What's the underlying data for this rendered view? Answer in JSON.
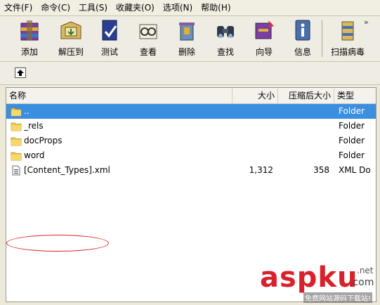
{
  "menu": [
    "文件(F)",
    "命令(C)",
    "工具(S)",
    "收藏夹(O)",
    "选项(N)",
    "帮助(H)"
  ],
  "toolbar": {
    "buttons": [
      {
        "label": "添加",
        "icon": "add-archive-icon"
      },
      {
        "label": "解压到",
        "icon": "extract-to-icon"
      },
      {
        "label": "测试",
        "icon": "test-icon"
      },
      {
        "label": "查看",
        "icon": "view-icon"
      },
      {
        "label": "删除",
        "icon": "delete-icon"
      },
      {
        "label": "查找",
        "icon": "find-icon"
      },
      {
        "label": "向导",
        "icon": "wizard-icon"
      },
      {
        "label": "信息",
        "icon": "info-icon"
      },
      {
        "label": "扫描病毒",
        "icon": "virus-scan-icon"
      }
    ],
    "overflow": "»"
  },
  "columns": {
    "name": "名称",
    "size": "大小",
    "packed": "压缩后大小",
    "type": "类型"
  },
  "files": [
    {
      "name": "..",
      "size": "",
      "packed": "",
      "type": "Folder",
      "kind": "folder",
      "selected": true
    },
    {
      "name": "_rels",
      "size": "",
      "packed": "",
      "type": "Folder",
      "kind": "folder"
    },
    {
      "name": "docProps",
      "size": "",
      "packed": "",
      "type": "Folder",
      "kind": "folder"
    },
    {
      "name": "word",
      "size": "",
      "packed": "",
      "type": "Folder",
      "kind": "folder"
    },
    {
      "name": "[Content_Types].xml",
      "size": "1,312",
      "packed": "358",
      "type": "XML Do",
      "kind": "file"
    }
  ],
  "watermark": {
    "main": "aspku",
    "net": ".net",
    "com": ".com",
    "sub": "免费网站源码下载站!"
  },
  "colors": {
    "selection": "#3b8fe0",
    "highlight_oval": "#d9232f",
    "watermark": "#d8212a"
  }
}
